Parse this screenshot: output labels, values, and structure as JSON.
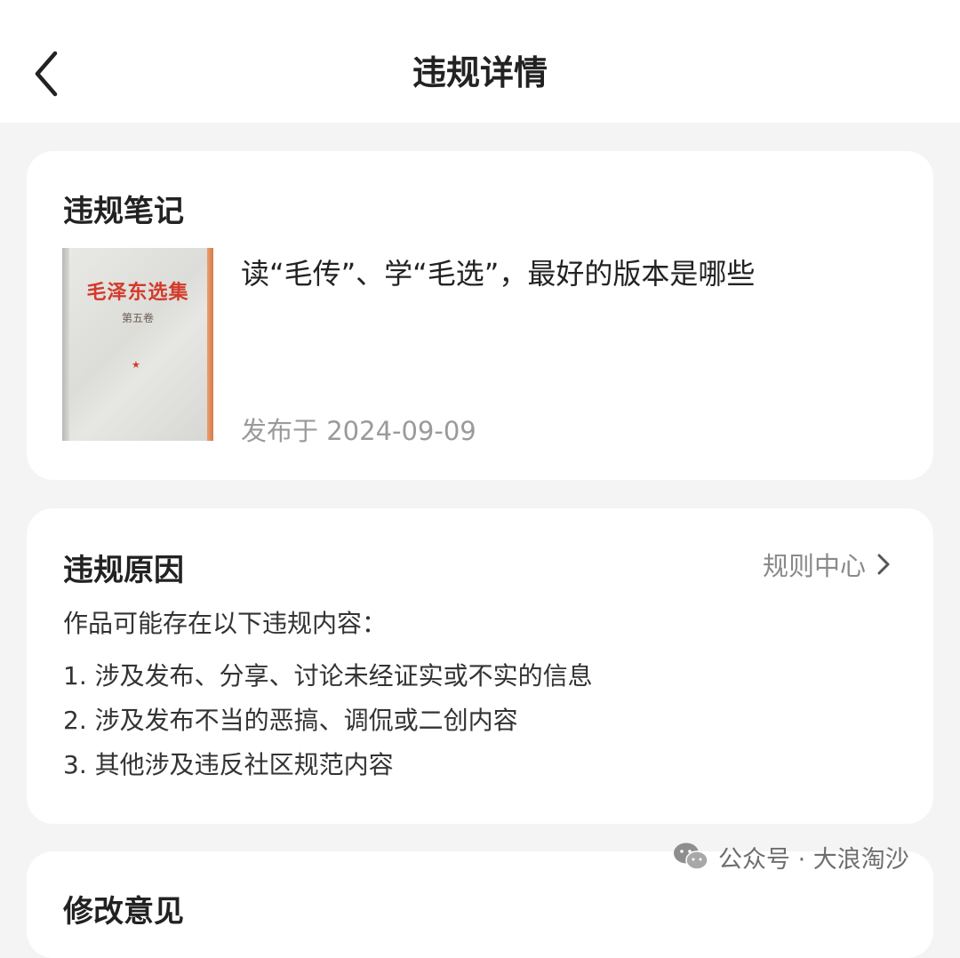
{
  "header": {
    "title": "违规详情",
    "back_icon": "chevron-left-icon"
  },
  "violation_note": {
    "section_title": "违规笔记",
    "thumbnail": {
      "book_title": "毛泽东选集",
      "volume": "第五卷"
    },
    "note_title": "读“毛传”、学“毛选”，最好的版本是哪些",
    "publish_text": "发布于 2024-09-09"
  },
  "violation_reason": {
    "section_title": "违规原因",
    "rules_link": "规则中心",
    "intro": "作品可能存在以下违规内容：",
    "items": [
      "1.  涉及发布、分享、讨论未经证实或不实的信息",
      "2.  涉及发布不当的恶搞、调侃或二创内容",
      "3.  其他涉及违反社区规范内容"
    ]
  },
  "next_section": {
    "section_title": "修改意见"
  },
  "watermark": {
    "text": "公众号 · 大浪淘沙",
    "icon": "wechat-icon"
  }
}
